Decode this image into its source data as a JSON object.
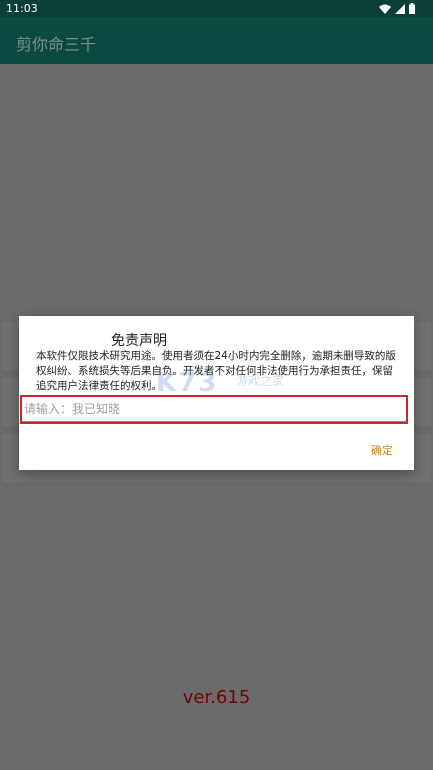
{
  "status_bar": {
    "time": "11:03",
    "icons": [
      "wifi-icon",
      "signal-icon",
      "battery-icon"
    ]
  },
  "app_bar": {
    "title": "剪你命三千"
  },
  "dialog": {
    "title": "免责声明",
    "message": "本软件仅限技术研究用途。使用者须在24小时内完全删除，逾期未删导致的版权纠纷、系统损失等后果自负。开发者不对任何非法使用行为承担责任，保留追究用户法律责任的权利。",
    "input_placeholder": "请输入：我已知晓",
    "input_value": "",
    "ok_label": "确定"
  },
  "watermark": {
    "logo": "K73",
    "text": "游戏之家"
  },
  "footer": {
    "version": "ver.615"
  },
  "colors": {
    "status_bar": "#0b3f37",
    "app_bar": "#0b4a41",
    "scrim": "#6a6a6a",
    "version_text": "#7a0000",
    "highlight_box": "#d0242a",
    "ok_button": "#c68a1a"
  }
}
